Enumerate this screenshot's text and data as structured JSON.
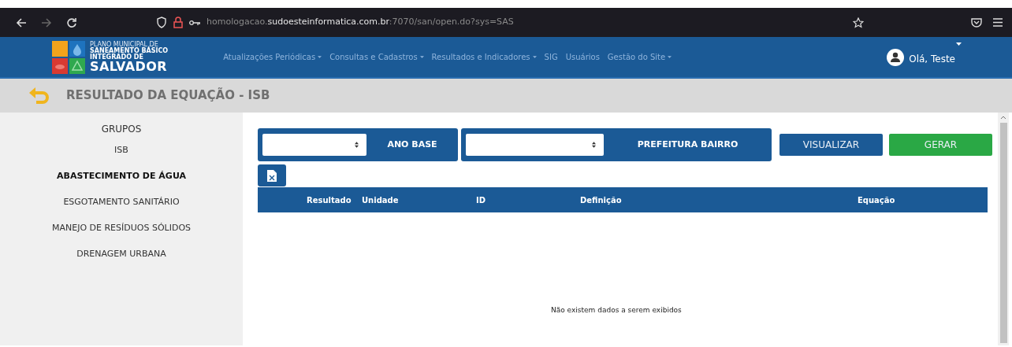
{
  "browser": {
    "url_host": "homologacao.",
    "url_domain": "sudoesteinformatica.com.br",
    "url_path": ":7070/san/open.do?sys=SAS"
  },
  "brand": {
    "line_1": "PLANO MUNICIPAL DE",
    "line_2": "SANEAMENTO BÁSICO",
    "line_3": "INTEGRADO DE",
    "name": "SALVADOR"
  },
  "nav": [
    {
      "label": "Atualizações Periódicas",
      "dropdown": true
    },
    {
      "label": "Consultas e Cadastros",
      "dropdown": true
    },
    {
      "label": "Resultados e Indicadores",
      "dropdown": true
    },
    {
      "label": "SIG",
      "dropdown": false
    },
    {
      "label": "Usuários",
      "dropdown": false
    },
    {
      "label": "Gestão do Site",
      "dropdown": true
    }
  ],
  "user": {
    "greeting": "Olá, Teste"
  },
  "page_title": "RESULTADO DA EQUAÇÃO - ISB",
  "sidebar": {
    "heading": "GRUPOS",
    "items": [
      {
        "label": "ISB",
        "selected": false
      },
      {
        "label": "ABASTECIMENTO DE ÁGUA",
        "selected": true
      },
      {
        "label": "ESGOTAMENTO SANITÁRIO",
        "selected": false
      },
      {
        "label": "MANEJO DE RESÍDUOS SÓLIDOS",
        "selected": false
      },
      {
        "label": "DRENAGEM URBANA",
        "selected": false
      }
    ]
  },
  "filters": [
    {
      "label": "ANO BASE"
    },
    {
      "label": "PREFEITURA BAIRRO"
    }
  ],
  "buttons": [
    {
      "label": "VISUALIZAR",
      "kind": "primary"
    },
    {
      "label": "GERAR",
      "kind": "success"
    }
  ],
  "table": {
    "columns": [
      "Resultado",
      "Unidade",
      "ID",
      "Definição",
      "Equação"
    ],
    "empty_message": "Não existem dados a serem exibidos"
  }
}
